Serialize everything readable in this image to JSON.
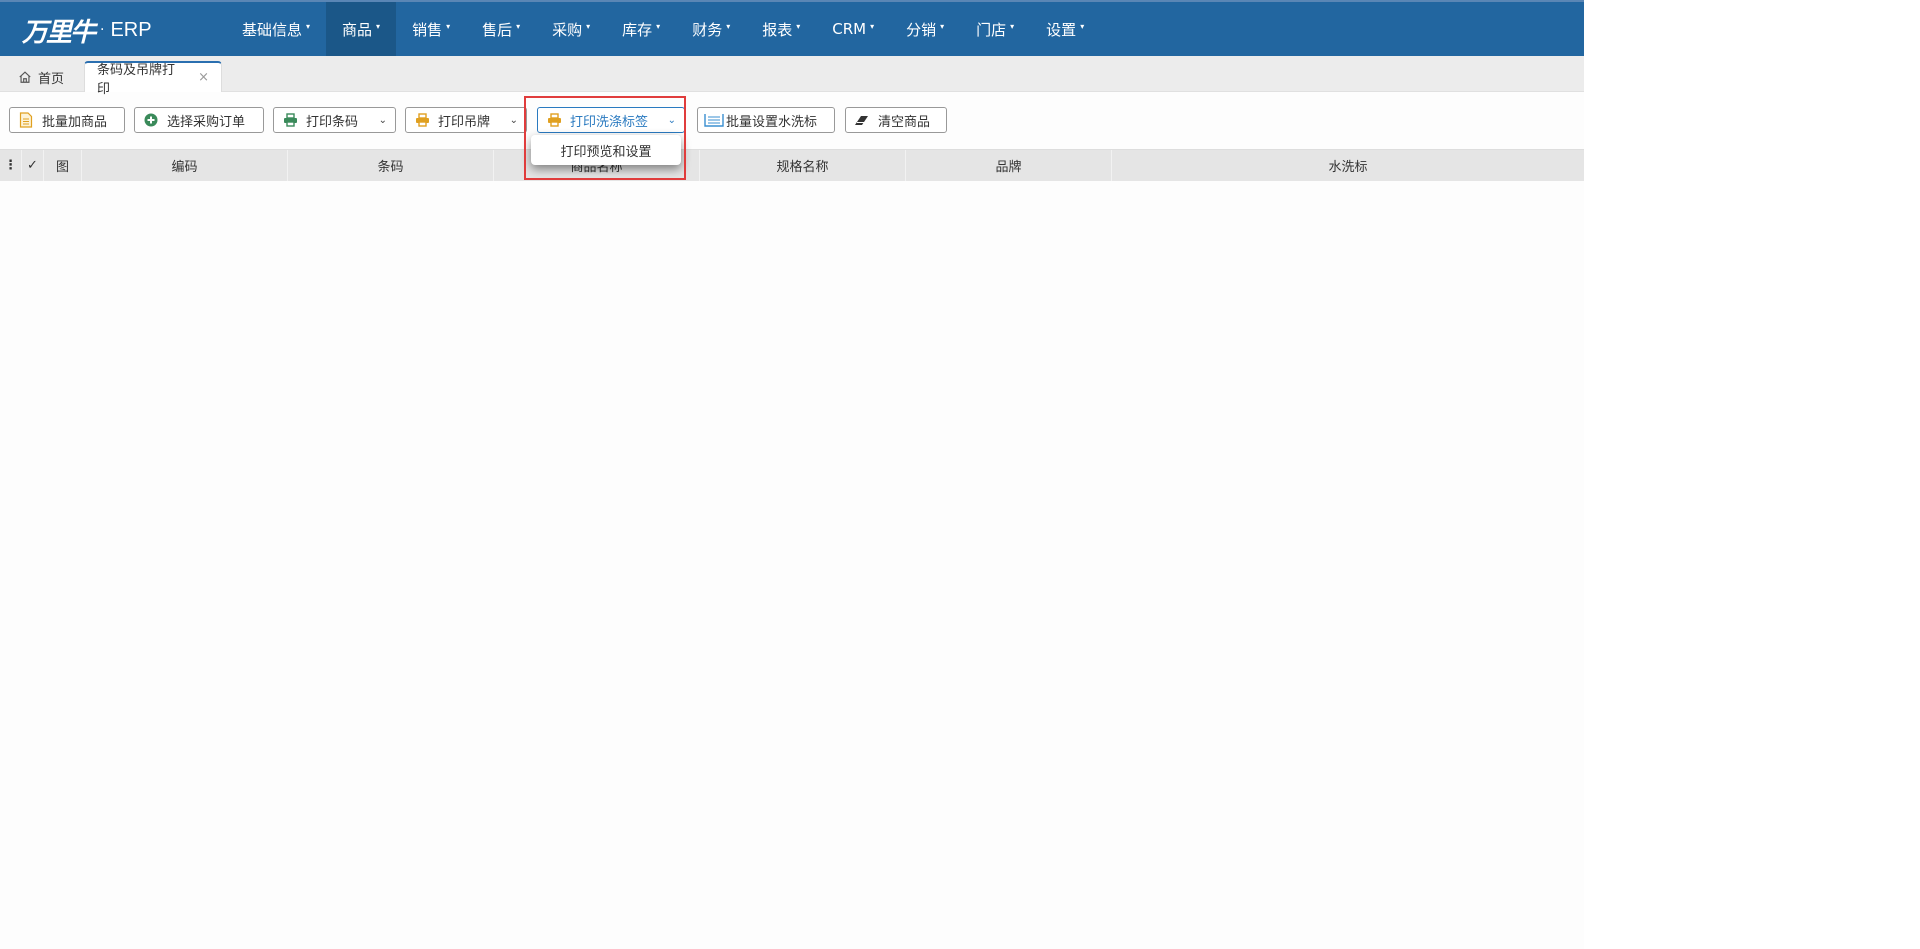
{
  "brand": {
    "logo_text": "万里牛",
    "separator": "·",
    "product": "ERP"
  },
  "nav": {
    "items": [
      {
        "label": "基础信息",
        "active": false
      },
      {
        "label": "商品",
        "active": true
      },
      {
        "label": "销售",
        "active": false
      },
      {
        "label": "售后",
        "active": false
      },
      {
        "label": "采购",
        "active": false
      },
      {
        "label": "库存",
        "active": false
      },
      {
        "label": "财务",
        "active": false
      },
      {
        "label": "报表",
        "active": false
      },
      {
        "label": "CRM",
        "active": false
      },
      {
        "label": "分销",
        "active": false
      },
      {
        "label": "门店",
        "active": false
      },
      {
        "label": "设置",
        "active": false
      }
    ],
    "caret": "▾"
  },
  "tabs": {
    "home": "首页",
    "active": "条码及吊牌打印",
    "close": "×"
  },
  "toolbar": {
    "batch_add": "批量加商品",
    "select_po": "选择采购订单",
    "print_barcode": "打印条码",
    "print_tag": "打印吊牌",
    "print_wash_label": "打印洗涤标签",
    "batch_wash": "批量设置水洗标",
    "clear": "清空商品",
    "dropdown_caret": "⌄"
  },
  "dropdown": {
    "items": [
      "打印预览和设置"
    ]
  },
  "grid": {
    "columns": [
      "⋮",
      "✓",
      "图",
      "编码",
      "条码",
      "商品名称",
      "规格名称",
      "品牌",
      "水洗标"
    ]
  },
  "colors": {
    "nav_bg": "#2266a0",
    "nav_active": "#1b5788",
    "primary": "#2a7ac0",
    "highlight": "#e03c3c",
    "printer_icon": "#e0a020",
    "printer_green": "#3a8a5a"
  }
}
